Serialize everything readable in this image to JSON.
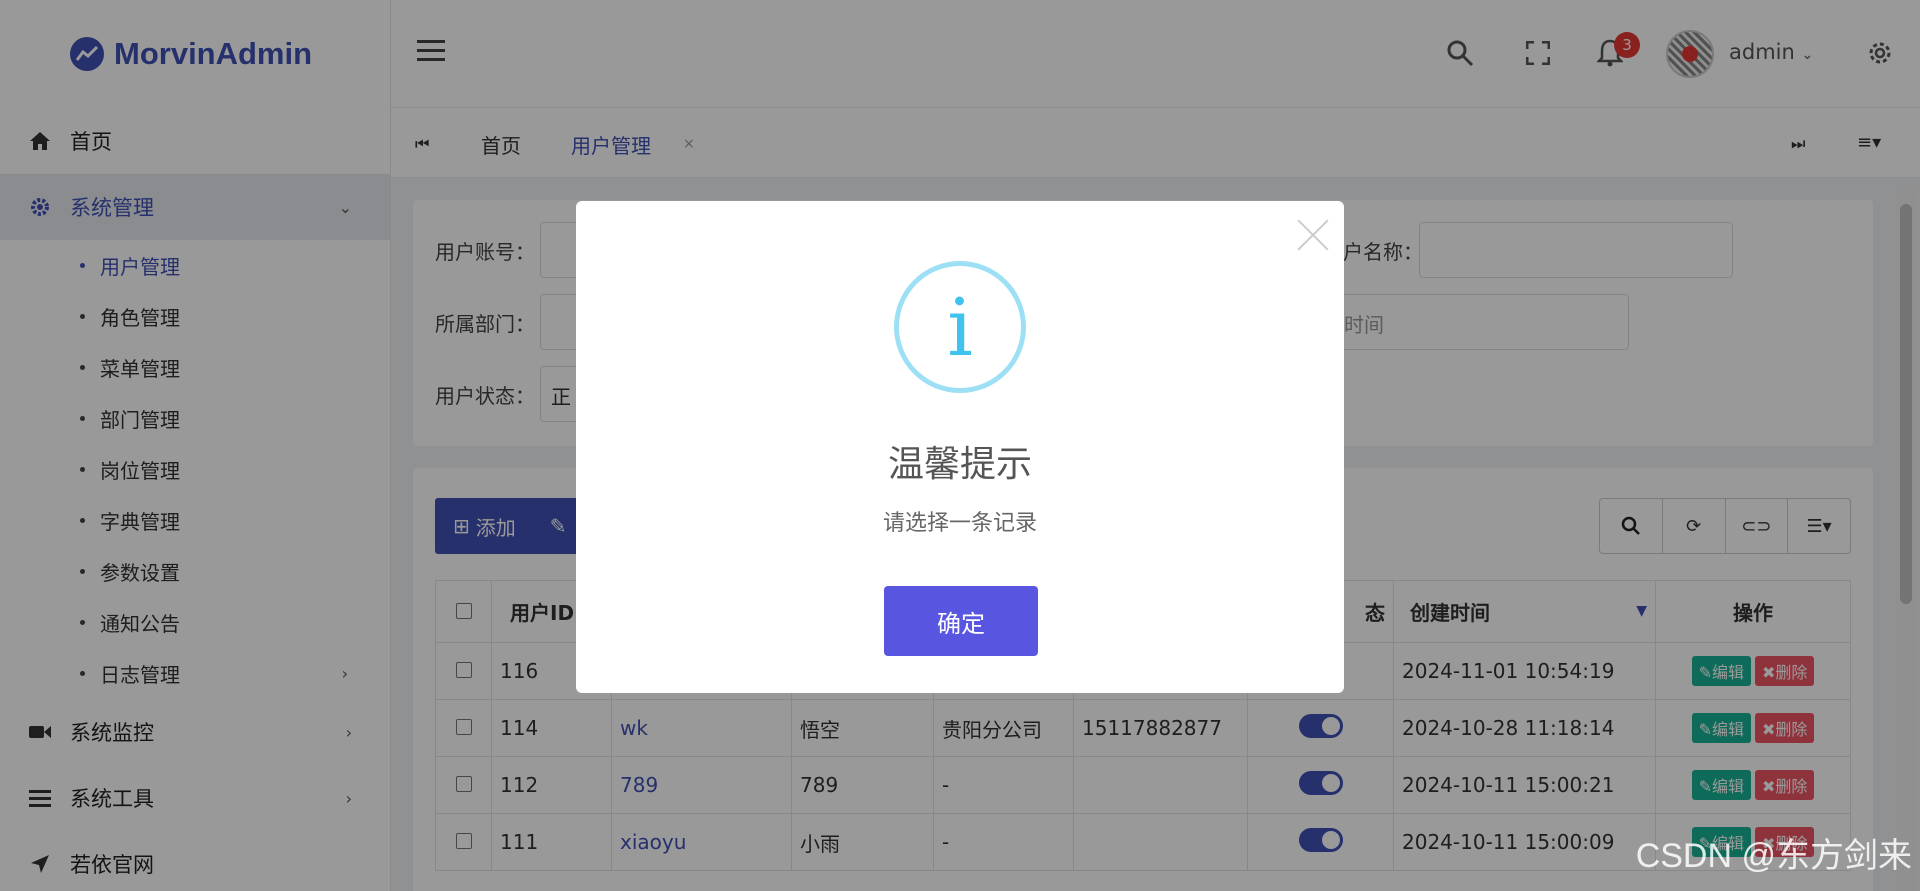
{
  "app": {
    "title": "MorvinAdmin"
  },
  "sidebar": {
    "items": [
      {
        "label": "首页",
        "icon": "home-icon"
      },
      {
        "label": "系统管理",
        "icon": "gear-icon",
        "active": true
      },
      {
        "label": "系统监控",
        "icon": "video-camera-icon"
      },
      {
        "label": "系统工具",
        "icon": "bars-icon"
      },
      {
        "label": "若依官网",
        "icon": "location-arrow-icon"
      }
    ],
    "sub_items": [
      "用户管理",
      "角色管理",
      "菜单管理",
      "部门管理",
      "岗位管理",
      "字典管理",
      "参数设置",
      "通知公告",
      "日志管理"
    ]
  },
  "header": {
    "username": "admin",
    "notification_count": "3"
  },
  "tabs": {
    "home": "首页",
    "current": "用户管理",
    "close": "×"
  },
  "search": {
    "account_label": "用户账号：",
    "dept_label": "所属部门：",
    "status_label": "用户状态：",
    "status_value_partial": "正",
    "name_label_partial": "户名称：",
    "end_time_placeholder_partial": "结束时间"
  },
  "toolbar": {
    "add_label": "添加"
  },
  "table": {
    "headers": {
      "user_id": "用户ID",
      "status_partial": "态",
      "created": "创建时间",
      "actions": "操作"
    },
    "edit_label": "编辑",
    "delete_label": "删除",
    "rows": [
      {
        "id": "116",
        "account": "",
        "name": "",
        "dept": "",
        "phone": "",
        "created": "2024-11-01 10:54:19"
      },
      {
        "id": "114",
        "account": "wk",
        "name": "悟空",
        "dept": "贵阳分公司",
        "phone": "15117882877",
        "created": "2024-10-28 11:18:14"
      },
      {
        "id": "112",
        "account": "789",
        "name": "789",
        "dept": "-",
        "phone": "",
        "created": "2024-10-11 15:00:21"
      },
      {
        "id": "111",
        "account": "xiaoyu",
        "name": "小雨",
        "dept": "-",
        "phone": "",
        "created": "2024-10-11 15:00:09"
      }
    ]
  },
  "modal": {
    "title": "温馨提示",
    "message": "请选择一条记录",
    "ok_label": "确定",
    "icon_glyph": "i"
  },
  "watermark": "CSDN @东方剑来",
  "colors": {
    "primary": "#3f51b5",
    "modal_button": "#5856e0",
    "info": "#3fc3ee",
    "edit": "#1ab394",
    "delete": "#ed5565"
  }
}
